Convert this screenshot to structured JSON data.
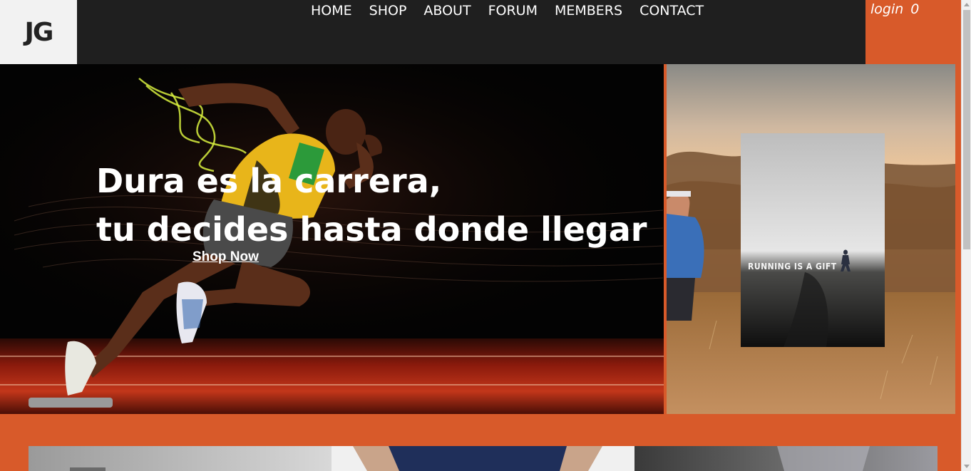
{
  "logo": {
    "text": "JG"
  },
  "nav": {
    "items": [
      {
        "label": "HOME"
      },
      {
        "label": "SHOP"
      },
      {
        "label": "ABOUT"
      },
      {
        "label": "FORUM"
      },
      {
        "label": "MEMBERS"
      },
      {
        "label": "CONTACT"
      }
    ]
  },
  "account": {
    "login_label": "login",
    "cart_count": "0"
  },
  "hero": {
    "title_line1": "Dura es la carrera,",
    "title_line2": "tu decides hasta donde llegar",
    "cta_label": "Shop Now"
  },
  "side_photo": {
    "poster_caption": "RUNNING IS A GIFT"
  },
  "colors": {
    "accent": "#d85a2a",
    "nav_bg": "#1f1f1f",
    "logo_bg": "#f2f2f2"
  }
}
